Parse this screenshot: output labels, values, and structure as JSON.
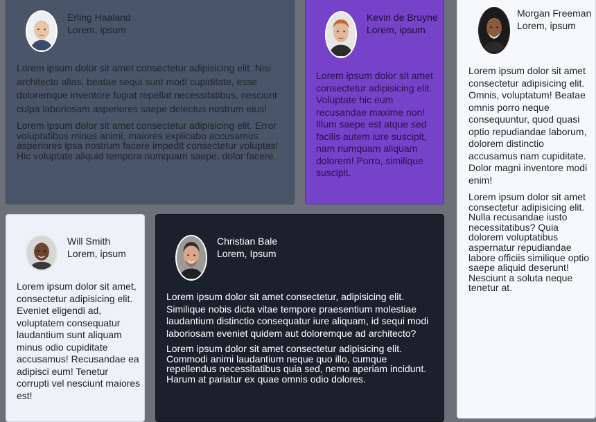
{
  "testimonials": [
    {
      "name": "Erling Haaland",
      "subtitle": "Lorem, ipsum",
      "avatar": "erling-haaland-photo",
      "paragraph1": "Lorem ipsum dolor sit amet consectetur adipisicing elit. Nisi architecto alias, beatae sequi sunt modi cupiditate, esse doloremque inventore fugiat repellat necessitatibus, nesciunt culpa laboriosam asperiores saepe delectus nostrum eius!",
      "paragraph2": "Lorem ipsum dolor sit amet consectetur adipisicing elit. Error voluptatibus minus animi, maiores explicabo accusamus asperiores ipsa nostrum facere impedit consectetur voluptas! Hic voluptate aliquid tempora numquam saepe, dolor facere.",
      "background": "#4a5569"
    },
    {
      "name": "Kevin de Bruyne",
      "subtitle": "Lorem, ipsum",
      "avatar": "kevin-de-bruyne-photo",
      "paragraph1": "Lorem ipsum dolor sit amet consectetur adipisicing elit. Voluptate hic eum recusandae maxime non! Illum saepe est atque sed facilis autem iure suscipit, nam numquam aliquam dolorem! Porro, similique suscipit.",
      "background": "#7542c9"
    },
    {
      "name": "Morgan Freeman",
      "subtitle": "Lorem, ipsum",
      "avatar": "morgan-freeman-photo",
      "paragraph1": "Lorem ipsum dolor sit amet consectetur adipisicing elit. Omnis, voluptatum! Beatae omnis porro neque consequuntur, quod quasi optio repudiandae laborum, dolorem distinctio accusamus nam cupiditate. Dolor magni inventore modi enim!",
      "paragraph2": "Lorem ipsum dolor sit amet consectetur adipisicing elit. Nulla recusandae iusto necessitatibus? Quia dolorem voluptatibus aspernatur repudiandae labore officiis similique optio saepe aliquid deserunt! Nesciunt a soluta neque tenetur at.",
      "background": "#f7f8fb"
    },
    {
      "name": "Will Smith",
      "subtitle": "Lorem, ipsum",
      "avatar": "will-smith-photo",
      "paragraph1": "Lorem ipsum dolor sit amet, consectetur adipisicing elit. Eveniet eligendi ad, voluptatem consequatur laudantium sunt aliquam minus odio cupiditate accusamus! Recusandae ea adipisci eum! Tenetur corrupti vel nesciunt maiores est!",
      "background": "#eef1f7"
    },
    {
      "name": "Christian Bale",
      "subtitle": "Lorem, Ipsum",
      "avatar": "christian-bale-photo",
      "paragraph1": "Lorem ipsum dolor sit amet consectetur, adipisicing elit. Similique nobis dicta vitae tempore praesentium molestiae laudantium distinctio consequatur iure aliquam, id sequi modi laboriosam eveniet quidem aut doloremque ad architecto?",
      "paragraph2": "Lorem ipsum dolor sit amet consectetur adipisicing elit. Commodi animi laudantium neque quo illo, cumque repellendus necessitatibus quia sed, nemo aperiam incidunt. Harum at pariatur ex quae omnis odio dolores.",
      "background": "#1a202c"
    }
  ]
}
